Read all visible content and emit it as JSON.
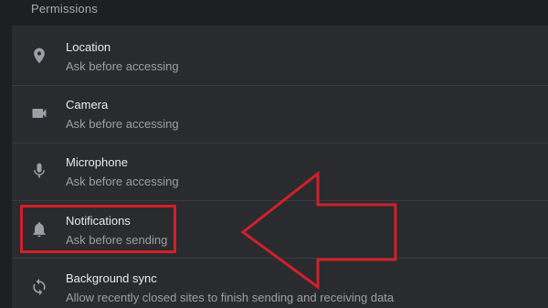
{
  "section": {
    "title": "Permissions"
  },
  "permissions": [
    {
      "icon": "location-pin-icon",
      "title": "Location",
      "subtitle": "Ask before accessing"
    },
    {
      "icon": "camera-icon",
      "title": "Camera",
      "subtitle": "Ask before accessing"
    },
    {
      "icon": "microphone-icon",
      "title": "Microphone",
      "subtitle": "Ask before accessing"
    },
    {
      "icon": "bell-icon",
      "title": "Notifications",
      "subtitle": "Ask before sending"
    },
    {
      "icon": "sync-icon",
      "title": "Background sync",
      "subtitle": "Allow recently closed sites to finish sending and receiving data"
    }
  ],
  "annotation": {
    "highlight_color": "#d0202a",
    "highlighted_item": "Notifications"
  },
  "colors": {
    "background": "#1e1f22",
    "card": "#2a2b2e",
    "title_text": "#e8eaed",
    "subtitle_text": "#9aa0a6",
    "icon": "#9aa0a6"
  }
}
